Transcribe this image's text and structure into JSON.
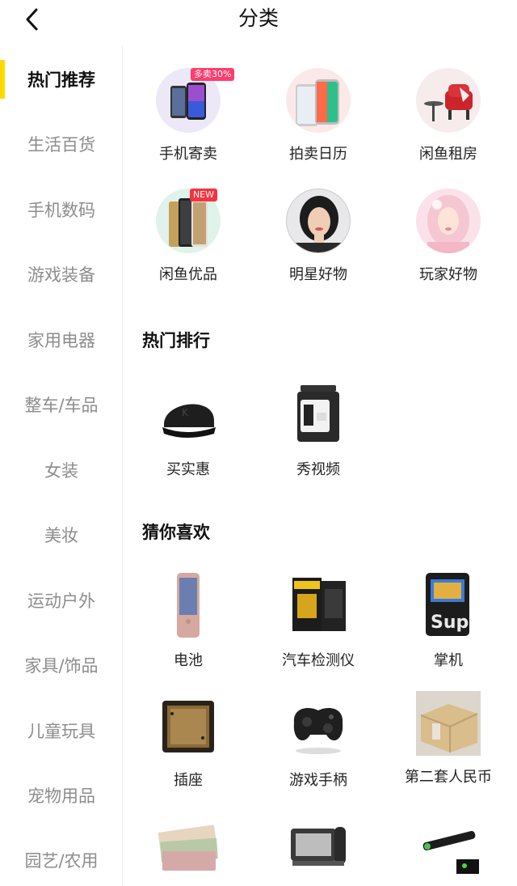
{
  "header": {
    "title": "分类"
  },
  "sidebar": {
    "items": [
      {
        "label": "热门推荐"
      },
      {
        "label": "生活百货"
      },
      {
        "label": "手机数码"
      },
      {
        "label": "游戏装备"
      },
      {
        "label": "家用电器"
      },
      {
        "label": "整车/车品"
      },
      {
        "label": "女装"
      },
      {
        "label": "美妆"
      },
      {
        "label": "运动户外"
      },
      {
        "label": "家具/饰品"
      },
      {
        "label": "儿童玩具"
      },
      {
        "label": "宠物用品"
      },
      {
        "label": "园艺/农用"
      }
    ]
  },
  "featured": [
    {
      "label": "手机寄卖",
      "badge": "多卖30%"
    },
    {
      "label": "拍卖日历"
    },
    {
      "label": "闲鱼租房"
    },
    {
      "label": "闲鱼优品",
      "badge": "NEW"
    },
    {
      "label": "明星好物"
    },
    {
      "label": "玩家好物"
    }
  ],
  "hot_rank": {
    "title": "热门排行",
    "items": [
      {
        "label": "买实惠"
      },
      {
        "label": "秀视频"
      }
    ]
  },
  "guess": {
    "title": "猜你喜欢",
    "items": [
      {
        "label": "电池"
      },
      {
        "label": "汽车检测仪"
      },
      {
        "label": "掌机"
      },
      {
        "label": "插座"
      },
      {
        "label": "游戏手柄"
      },
      {
        "label": "第二套人民币"
      }
    ]
  },
  "colors": {
    "accent": "#ffda00",
    "badge_pink": "#ff3d6e",
    "badge_red": "#f5333f"
  }
}
